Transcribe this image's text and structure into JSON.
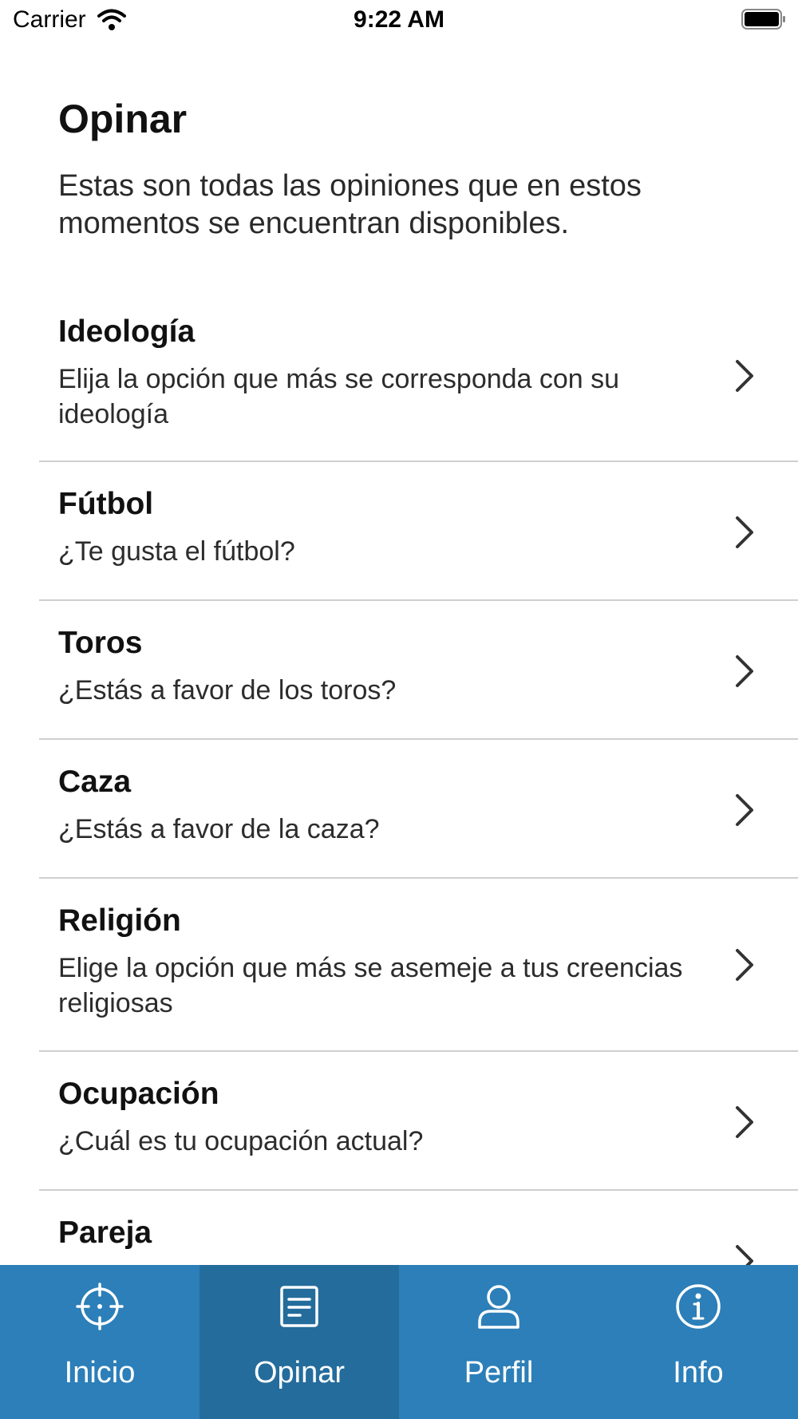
{
  "status_bar": {
    "carrier": "Carrier",
    "time": "9:22 AM"
  },
  "header": {
    "title": "Opinar",
    "subtitle": "Estas son todas las opiniones que en estos momentos se encuentran disponibles."
  },
  "items": [
    {
      "title": "Ideología",
      "description": "Elija la opción que más se corresponda con su ideología"
    },
    {
      "title": "Fútbol",
      "description": "¿Te gusta el fútbol?"
    },
    {
      "title": "Toros",
      "description": "¿Estás a favor de los toros?"
    },
    {
      "title": "Caza",
      "description": "¿Estás a favor de la caza?"
    },
    {
      "title": "Religión",
      "description": "Elige la opción que más se asemeje a tus creencias religiosas"
    },
    {
      "title": "Ocupación",
      "description": "¿Cuál es tu ocupación actual?"
    },
    {
      "title": "Pareja",
      "description": ""
    }
  ],
  "tab_bar": {
    "tabs": [
      {
        "label": "Inicio",
        "icon": "crosshair-icon"
      },
      {
        "label": "Opinar",
        "icon": "document-icon"
      },
      {
        "label": "Perfil",
        "icon": "user-icon"
      },
      {
        "label": "Info",
        "icon": "info-icon"
      }
    ],
    "active": "Opinar"
  },
  "colors": {
    "tab_bar": "#2c7fb8",
    "tab_active": "#246c9c",
    "separator": "#cfcfcf"
  }
}
